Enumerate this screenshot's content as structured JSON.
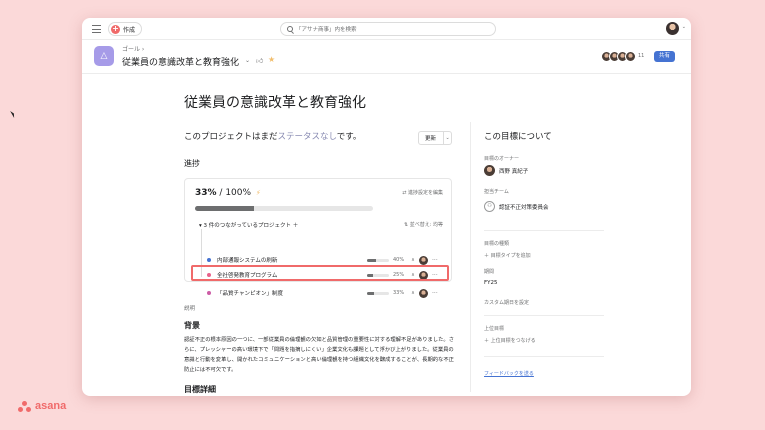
{
  "topbar": {
    "create_label": "作成",
    "search_placeholder": "「アサナ商事」内を検索"
  },
  "goal_header": {
    "breadcrumb": "ゴール ›",
    "title": "従業員の意識改革と教育強化",
    "member_count": "11",
    "share_label": "共有"
  },
  "main": {
    "page_title": "従業員の意識改革と教育強化",
    "status_prefix": "このプロジェクトはまだ",
    "status_link": "ステータスなし",
    "status_suffix": "です。",
    "update_label": "更新",
    "progress_heading": "進捗",
    "progress": {
      "current": "33%",
      "target": "/ 100%",
      "fraction": 0.33,
      "settings_label": "進捗設定を編集",
      "projects_header": "3 件のつながっているプロジェクト",
      "sort_label": "並べ替え: 均等"
    },
    "projects": [
      {
        "name": "内部通報システムの刷新",
        "pct": "40%",
        "fraction": 0.4,
        "color": "#4573d2"
      },
      {
        "name": "全社啓発教育プログラム",
        "pct": "25%",
        "fraction": 0.25,
        "color": "#e8628b"
      },
      {
        "name": "「品質チャンピオン」制度",
        "pct": "33%",
        "fraction": 0.33,
        "color": "#cd5ca6"
      }
    ],
    "description_label": "説明",
    "background_heading": "背景",
    "background_text": "認証不正の根本原因の一つに、一部従業員の倫理観の欠如と品質管理の重要性に対する理解不足がありました。さらに、プレッシャーの高い環境下で「問題を指摘しにくい」企業文化も課題として浮かび上がりました。従業員の意識と行動を変革し、開かれたコミュニケーションと高い倫理観を持つ組織文化を醸成することが、長期的な不正防止には不可欠です。",
    "detail_heading": "目標詳細"
  },
  "right_panel": {
    "title": "この目標について",
    "owner_label": "目標のオーナー",
    "owner_name": "西野 真紀子",
    "team_label": "担当チーム",
    "team_name": "認証不正対策委員会",
    "goal_type_label": "目標の種類",
    "goal_type_add": "目標タイプを追加",
    "period_label": "期間",
    "period_value": "FY25",
    "custom_period": "カスタム期日を設定",
    "parent_label": "上位目標",
    "parent_add": "上位目標をつなげる",
    "feedback": "フィードバックを送る"
  },
  "branding": {
    "logo_text": "asana"
  }
}
